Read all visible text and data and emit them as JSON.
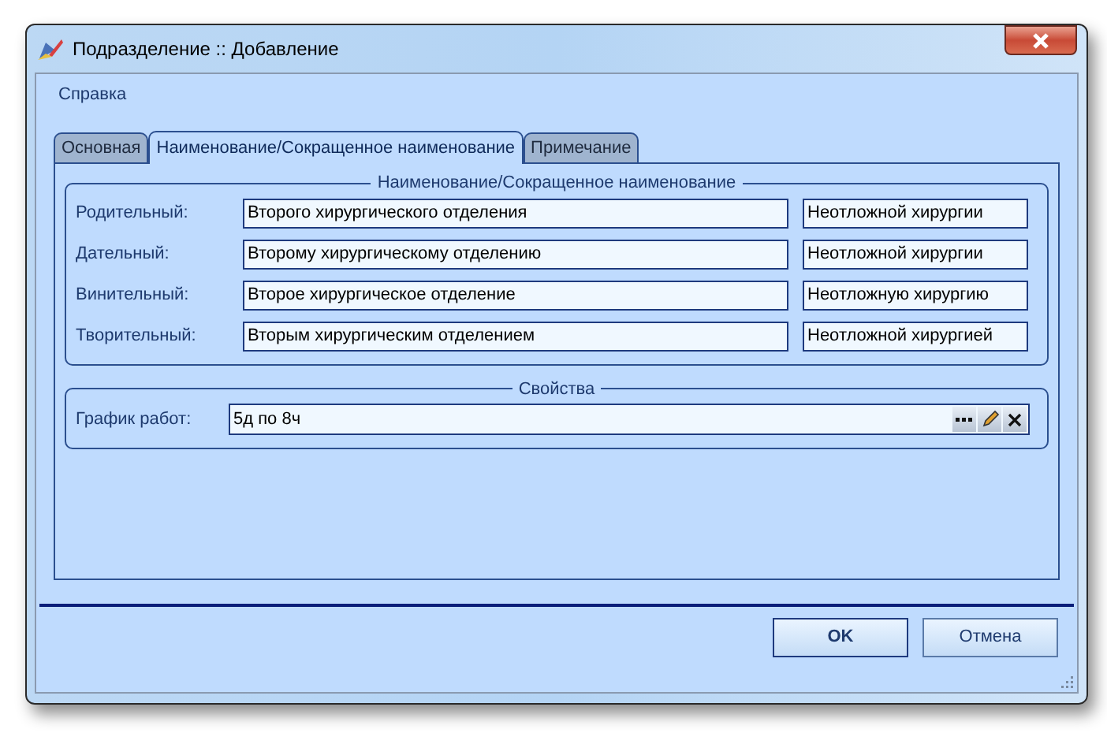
{
  "window": {
    "title": "Подразделение :: Добавление"
  },
  "menu": [
    "Справка"
  ],
  "tabs": [
    {
      "label": "Основная",
      "selected": false
    },
    {
      "label": "Наименование/Сокращенное наименование",
      "selected": true
    },
    {
      "label": "Примечание",
      "selected": false
    }
  ],
  "names_group": {
    "title": "Наименование/Сокращенное наименование",
    "rows": [
      {
        "label": "Родительный:",
        "full": "Второго хирургического отделения",
        "short": "Неотложной хирургии"
      },
      {
        "label": "Дательный:",
        "full": "Второму хирургическому отделению",
        "short": "Неотложной хирургии"
      },
      {
        "label": "Винительный:",
        "full": "Второе хирургическое отделение",
        "short": "Неотложную хирургию"
      },
      {
        "label": "Творительный:",
        "full": "Вторым хирургическим отделением",
        "short": "Неотложной хирургией"
      }
    ]
  },
  "properties_group": {
    "title": "Свойства",
    "schedule": {
      "label": "График работ:",
      "value": "5д по 8ч"
    }
  },
  "buttons": [
    {
      "label": "OK",
      "default": true
    },
    {
      "label": "Отмена",
      "default": false
    }
  ]
}
